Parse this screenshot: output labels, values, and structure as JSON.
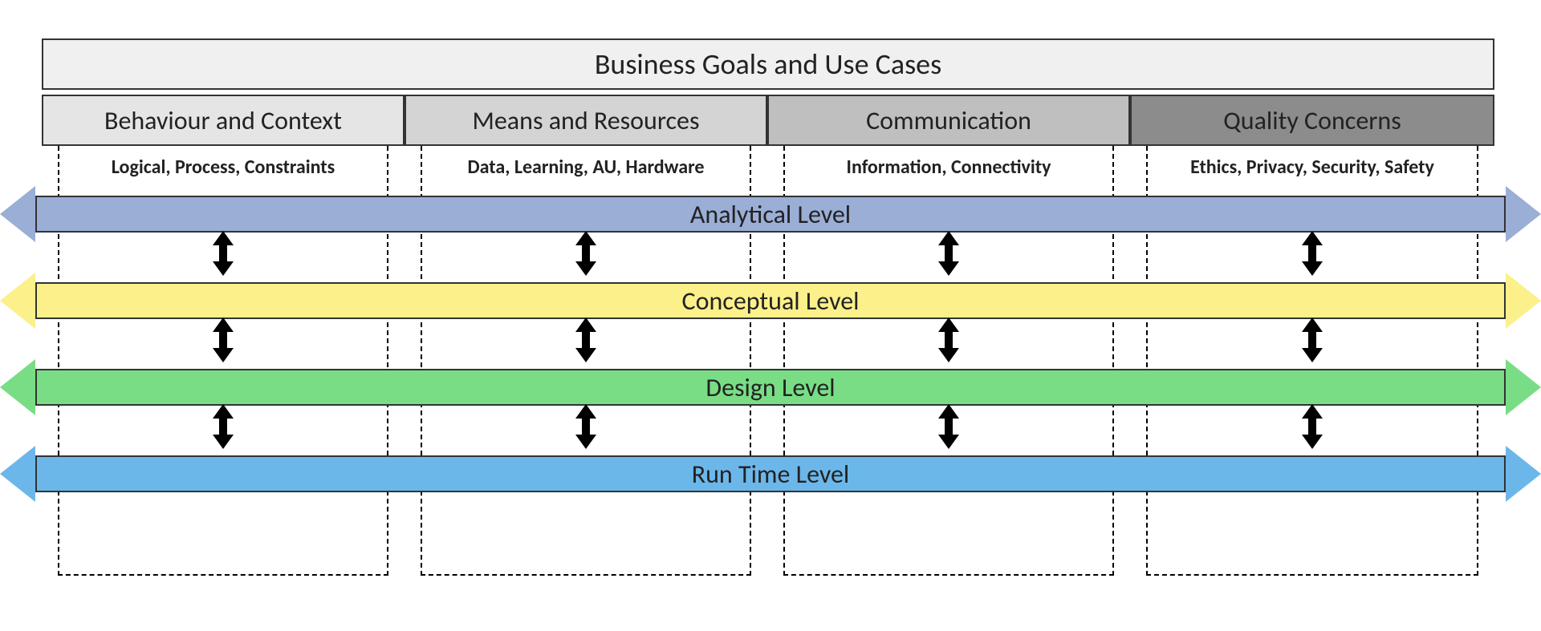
{
  "header": {
    "title": "Business Goals and Use Cases"
  },
  "aspects": [
    {
      "label": "Behaviour and Context",
      "sublabel": "Logical, Process, Constraints"
    },
    {
      "label": "Means and Resources",
      "sublabel": "Data, Learning, AU, Hardware"
    },
    {
      "label": "Communication",
      "sublabel": "Information, Connectivity"
    },
    {
      "label": "Quality Concerns",
      "sublabel": "Ethics, Privacy, Security, Safety"
    }
  ],
  "levels": [
    {
      "label": "Analytical Level"
    },
    {
      "label": "Conceptual Level"
    },
    {
      "label": "Design Level"
    },
    {
      "label": "Run Time Level"
    }
  ],
  "colors": {
    "analytical": "#9aaed6",
    "conceptual": "#fbf08a",
    "design": "#79dd85",
    "runtime": "#6cb7ea"
  }
}
